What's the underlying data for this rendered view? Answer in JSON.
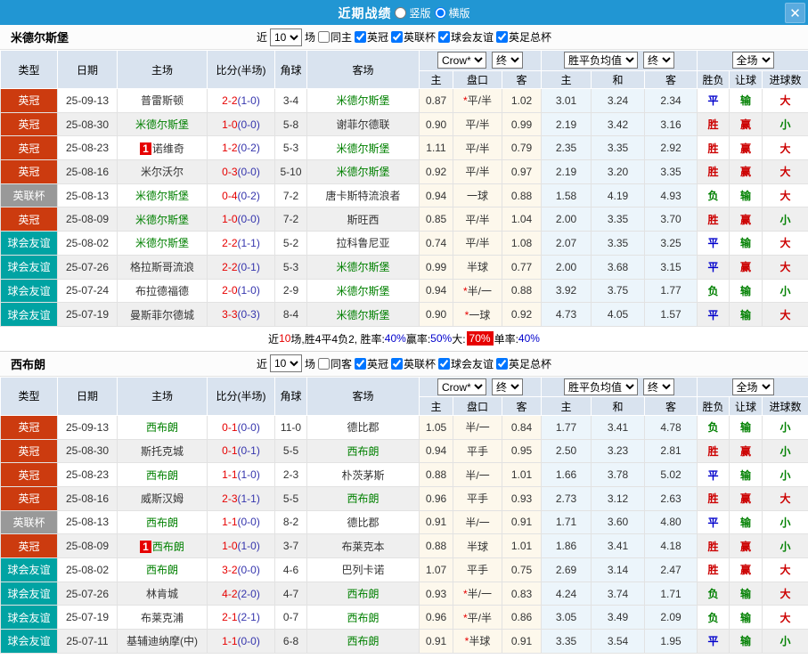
{
  "colors": {
    "type": {
      "英冠": "#cc3b0f",
      "英联杯": "#999999",
      "球会友谊": "#00a3a3",
      "英足总杯": "#999999"
    },
    "result": {
      "胜": "#cc0000",
      "平": "#0000cc",
      "负": "#008000",
      "赢": "#cc0000",
      "输": "#008000",
      "大": "#cc0000",
      "小": "#008000"
    },
    "titlebar_bg": "#2196d3",
    "header_bg": "#d9e3ef",
    "odds_bg": "#fdf8ec",
    "mean_bg": "#ecf5fb"
  },
  "titlebar": {
    "title": "近期战绩",
    "radio_vertical": "竖版",
    "radio_horizontal": "横版",
    "radio_horizontal_checked": "checked",
    "close": "✕"
  },
  "header": {
    "type": "类型",
    "date": "日期",
    "home": "主场",
    "score": "比分(半场)",
    "corner": "角球",
    "away": "客场",
    "bookmaker": "Crow*",
    "final1": "终",
    "mean": "胜平负均值",
    "final2": "终",
    "full": "全场",
    "odds_home": "主",
    "odds_line": "盘口",
    "odds_away": "客",
    "mean_home": "主",
    "mean_draw": "和",
    "mean_away": "客",
    "wdl": "胜负",
    "handicap": "让球",
    "goals": "进球数"
  },
  "sections": [
    {
      "team": "米德尔斯堡",
      "near_label": "近",
      "near_value": "10",
      "games_label": "场",
      "same_label": "同主",
      "leagues": [
        {
          "label": "英冠",
          "checked": "checked"
        },
        {
          "label": "英联杯",
          "checked": "checked"
        },
        {
          "label": "球会友谊",
          "checked": "checked"
        },
        {
          "label": "英足总杯",
          "checked": "checked"
        }
      ],
      "rows": [
        {
          "type": "英冠",
          "date": "25-09-13",
          "home": "普雷斯顿",
          "score": "2-2",
          "half": "(1-0)",
          "corner": "3-4",
          "away": "米德尔斯堡",
          "o1": "0.87",
          "star": true,
          "line": "平/半",
          "o2": "1.02",
          "m1": "3.01",
          "m2": "3.24",
          "m3": "2.34",
          "r1": "平",
          "r2": "输",
          "r3": "大"
        },
        {
          "type": "英冠",
          "date": "25-08-30",
          "home": "米德尔斯堡",
          "score": "1-0",
          "half": "(0-0)",
          "corner": "5-8",
          "away": "谢菲尔德联",
          "o1": "0.90",
          "star": false,
          "line": "平/半",
          "o2": "0.99",
          "m1": "2.19",
          "m2": "3.42",
          "m3": "3.16",
          "r1": "胜",
          "r2": "赢",
          "r3": "小"
        },
        {
          "type": "英冠",
          "date": "25-08-23",
          "home": "诺维奇",
          "badge": "1",
          "score": "1-2",
          "half": "(0-2)",
          "corner": "5-3",
          "away": "米德尔斯堡",
          "o1": "1.11",
          "star": false,
          "line": "平/半",
          "o2": "0.79",
          "m1": "2.35",
          "m2": "3.35",
          "m3": "2.92",
          "r1": "胜",
          "r2": "赢",
          "r3": "大"
        },
        {
          "type": "英冠",
          "date": "25-08-16",
          "home": "米尔沃尔",
          "score": "0-3",
          "half": "(0-0)",
          "corner": "5-10",
          "away": "米德尔斯堡",
          "o1": "0.92",
          "star": false,
          "line": "平/半",
          "o2": "0.97",
          "m1": "2.19",
          "m2": "3.20",
          "m3": "3.35",
          "r1": "胜",
          "r2": "赢",
          "r3": "大"
        },
        {
          "type": "英联杯",
          "date": "25-08-13",
          "home": "米德尔斯堡",
          "score": "0-4",
          "half": "(0-2)",
          "corner": "7-2",
          "away": "唐卡斯特流浪者",
          "o1": "0.94",
          "star": false,
          "line": "一球",
          "o2": "0.88",
          "m1": "1.58",
          "m2": "4.19",
          "m3": "4.93",
          "r1": "负",
          "r2": "输",
          "r3": "大"
        },
        {
          "type": "英冠",
          "date": "25-08-09",
          "home": "米德尔斯堡",
          "score": "1-0",
          "half": "(0-0)",
          "corner": "7-2",
          "away": "斯旺西",
          "o1": "0.85",
          "star": false,
          "line": "平/半",
          "o2": "1.04",
          "m1": "2.00",
          "m2": "3.35",
          "m3": "3.70",
          "r1": "胜",
          "r2": "赢",
          "r3": "小"
        },
        {
          "type": "球会友谊",
          "date": "25-08-02",
          "home": "米德尔斯堡",
          "score": "2-2",
          "half": "(1-1)",
          "corner": "5-2",
          "away": "拉科鲁尼亚",
          "o1": "0.74",
          "star": false,
          "line": "平/半",
          "o2": "1.08",
          "m1": "2.07",
          "m2": "3.35",
          "m3": "3.25",
          "r1": "平",
          "r2": "输",
          "r3": "大"
        },
        {
          "type": "球会友谊",
          "date": "25-07-26",
          "home": "格拉斯哥流浪",
          "score": "2-2",
          "half": "(0-1)",
          "corner": "5-3",
          "away": "米德尔斯堡",
          "o1": "0.99",
          "star": false,
          "line": "半球",
          "o2": "0.77",
          "m1": "2.00",
          "m2": "3.68",
          "m3": "3.15",
          "r1": "平",
          "r2": "赢",
          "r3": "大"
        },
        {
          "type": "球会友谊",
          "date": "25-07-24",
          "home": "布拉德福德",
          "score": "2-0",
          "half": "(1-0)",
          "corner": "2-9",
          "away": "米德尔斯堡",
          "o1": "0.94",
          "star": true,
          "line": "半/一",
          "o2": "0.88",
          "m1": "3.92",
          "m2": "3.75",
          "m3": "1.77",
          "r1": "负",
          "r2": "输",
          "r3": "小"
        },
        {
          "type": "球会友谊",
          "date": "25-07-19",
          "home": "曼斯菲尔德城",
          "score": "3-3",
          "half": "(0-3)",
          "corner": "8-4",
          "away": "米德尔斯堡",
          "o1": "0.90",
          "star": true,
          "line": "一球",
          "o2": "0.92",
          "m1": "4.73",
          "m2": "4.05",
          "m3": "1.57",
          "r1": "平",
          "r2": "输",
          "r3": "大"
        }
      ],
      "summary": {
        "p1": "近",
        "count": "10",
        "p2": "场,胜4平4负2, 胜率:",
        "win_rate": "40%",
        "p3": " 赢率:",
        "cover_rate": "50%",
        "p4": " 大:",
        "big_rate": "70%",
        "p5": " 单率:",
        "single_rate": "40%"
      }
    },
    {
      "team": "西布朗",
      "near_label": "近",
      "near_value": "10",
      "games_label": "场",
      "same_label": "同客",
      "leagues": [
        {
          "label": "英冠",
          "checked": "checked"
        },
        {
          "label": "英联杯",
          "checked": "checked"
        },
        {
          "label": "球会友谊",
          "checked": "checked"
        },
        {
          "label": "英足总杯",
          "checked": "checked"
        }
      ],
      "rows": [
        {
          "type": "英冠",
          "date": "25-09-13",
          "home": "西布朗",
          "score": "0-1",
          "half": "(0-0)",
          "corner": "11-0",
          "away": "德比郡",
          "o1": "1.05",
          "star": false,
          "line": "半/一",
          "o2": "0.84",
          "m1": "1.77",
          "m2": "3.41",
          "m3": "4.78",
          "r1": "负",
          "r2": "输",
          "r3": "小"
        },
        {
          "type": "英冠",
          "date": "25-08-30",
          "home": "斯托克城",
          "score": "0-1",
          "half": "(0-1)",
          "corner": "5-5",
          "away": "西布朗",
          "o1": "0.94",
          "star": false,
          "line": "平手",
          "o2": "0.95",
          "m1": "2.50",
          "m2": "3.23",
          "m3": "2.81",
          "r1": "胜",
          "r2": "赢",
          "r3": "小"
        },
        {
          "type": "英冠",
          "date": "25-08-23",
          "home": "西布朗",
          "score": "1-1",
          "half": "(1-0)",
          "corner": "2-3",
          "away": "朴茨茅斯",
          "o1": "0.88",
          "star": false,
          "line": "半/一",
          "o2": "1.01",
          "m1": "1.66",
          "m2": "3.78",
          "m3": "5.02",
          "r1": "平",
          "r2": "输",
          "r3": "小"
        },
        {
          "type": "英冠",
          "date": "25-08-16",
          "home": "威斯汉姆",
          "score": "2-3",
          "half": "(1-1)",
          "corner": "5-5",
          "away": "西布朗",
          "o1": "0.96",
          "star": false,
          "line": "平手",
          "o2": "0.93",
          "m1": "2.73",
          "m2": "3.12",
          "m3": "2.63",
          "r1": "胜",
          "r2": "赢",
          "r3": "大"
        },
        {
          "type": "英联杯",
          "date": "25-08-13",
          "home": "西布朗",
          "score": "1-1",
          "half": "(0-0)",
          "corner": "8-2",
          "away": "德比郡",
          "o1": "0.91",
          "star": false,
          "line": "半/一",
          "o2": "0.91",
          "m1": "1.71",
          "m2": "3.60",
          "m3": "4.80",
          "r1": "平",
          "r2": "输",
          "r3": "小"
        },
        {
          "type": "英冠",
          "date": "25-08-09",
          "home": "西布朗",
          "badge": "1",
          "score": "1-0",
          "half": "(1-0)",
          "corner": "3-7",
          "away": "布莱克本",
          "o1": "0.88",
          "star": false,
          "line": "半球",
          "o2": "1.01",
          "m1": "1.86",
          "m2": "3.41",
          "m3": "4.18",
          "r1": "胜",
          "r2": "赢",
          "r3": "小"
        },
        {
          "type": "球会友谊",
          "date": "25-08-02",
          "home": "西布朗",
          "score": "3-2",
          "half": "(0-0)",
          "corner": "4-6",
          "away": "巴列卡诺",
          "o1": "1.07",
          "star": false,
          "line": "平手",
          "o2": "0.75",
          "m1": "2.69",
          "m2": "3.14",
          "m3": "2.47",
          "r1": "胜",
          "r2": "赢",
          "r3": "大"
        },
        {
          "type": "球会友谊",
          "date": "25-07-26",
          "home": "林肯城",
          "score": "4-2",
          "half": "(2-0)",
          "corner": "4-7",
          "away": "西布朗",
          "o1": "0.93",
          "star": true,
          "line": "半/一",
          "o2": "0.83",
          "m1": "4.24",
          "m2": "3.74",
          "m3": "1.71",
          "r1": "负",
          "r2": "输",
          "r3": "大"
        },
        {
          "type": "球会友谊",
          "date": "25-07-19",
          "home": "布莱克浦",
          "score": "2-1",
          "half": "(2-1)",
          "corner": "0-7",
          "away": "西布朗",
          "o1": "0.96",
          "star": true,
          "line": "平/半",
          "o2": "0.86",
          "m1": "3.05",
          "m2": "3.49",
          "m3": "2.09",
          "r1": "负",
          "r2": "输",
          "r3": "大"
        },
        {
          "type": "球会友谊",
          "date": "25-07-11",
          "home": "基辅迪纳摩(中)",
          "score": "1-1",
          "half": "(0-0)",
          "corner": "6-8",
          "away": "西布朗",
          "o1": "0.91",
          "star": true,
          "line": "半球",
          "o2": "0.91",
          "m1": "3.35",
          "m2": "3.54",
          "m3": "1.95",
          "r1": "平",
          "r2": "输",
          "r3": "小"
        }
      ]
    }
  ]
}
